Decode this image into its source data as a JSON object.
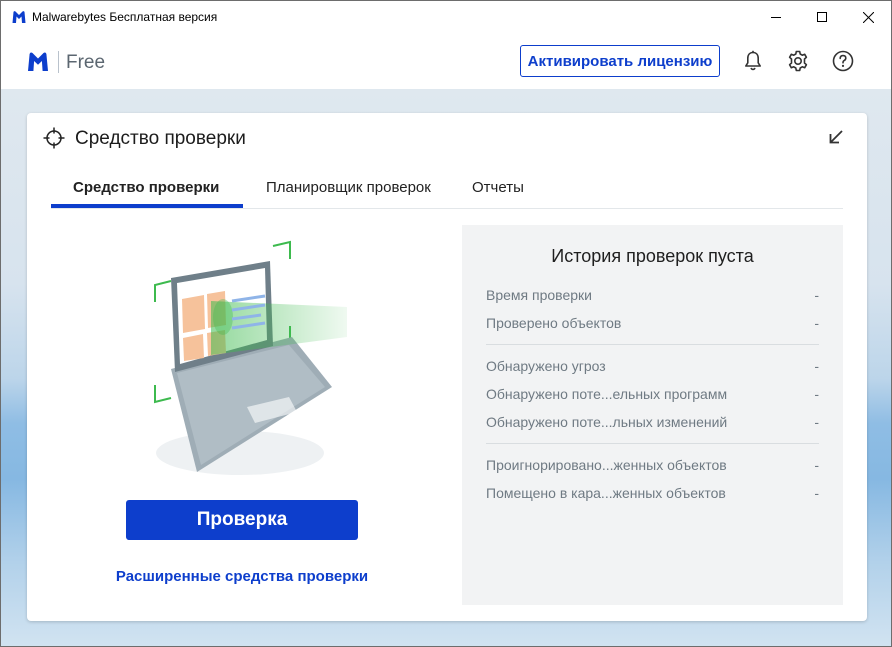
{
  "window": {
    "title": "Malwarebytes Бесплатная версия"
  },
  "header": {
    "brand": "Free",
    "activate_label": "Активировать лицензию"
  },
  "card": {
    "title": "Средство проверки",
    "tabs": [
      {
        "label": "Средство проверки",
        "active": true
      },
      {
        "label": "Планировщик проверок",
        "active": false
      },
      {
        "label": "Отчеты",
        "active": false
      }
    ],
    "scan_label": "Проверка",
    "advanced_label": "Расширенные средства проверки"
  },
  "history": {
    "title": "История проверок пуста",
    "rows": [
      {
        "label": "Время проверки",
        "value": "-"
      },
      {
        "label": "Проверено объектов",
        "value": "-"
      },
      {
        "label": "Обнаружено угроз",
        "value": "-"
      },
      {
        "label": "Обнаружено поте...ельных программ",
        "value": "-"
      },
      {
        "label": "Обнаружено поте...льных изменений",
        "value": "-"
      },
      {
        "label": "Проигнорировано...женных объектов",
        "value": "-"
      },
      {
        "label": "Помещено в кара...женных объектов",
        "value": "-"
      }
    ]
  },
  "colors": {
    "accent": "#0d3ecc",
    "scan_green": "#3dba4e"
  }
}
